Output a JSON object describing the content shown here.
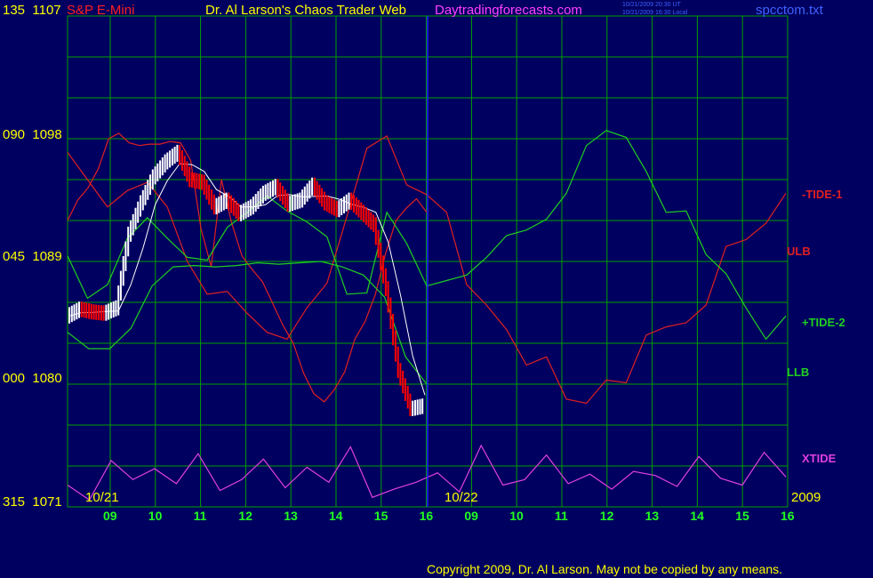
{
  "header": {
    "symbol": "S&P E-Mini",
    "title": "Dr. Al Larson's Chaos Trader Web",
    "site": "Daytradingforecasts.com",
    "stamp_ut": "10/21/2009 20:30 UT",
    "stamp_local": "10/21/2009 16:30 Local",
    "file": "spcctom.txt"
  },
  "footer": {
    "copyright": "Copyright 2009, Dr. Al Larson. May not be copied by any means."
  },
  "colors": {
    "background": "#000060",
    "grid": "#00a000",
    "price_up": "#ffffff",
    "price_down": "#ff0000",
    "red_line": "#e02020",
    "green_line": "#20d020",
    "xtide": "#e040e0",
    "divider": "#2020ff",
    "yellow": "#ffff00",
    "header_red": "#ff2020",
    "header_magenta": "#ff40ff",
    "header_blue": "#4060ff"
  },
  "chart_data": {
    "type": "line",
    "y_axis_labels": [
      {
        "left": "135",
        "right": "1107",
        "value": 1107
      },
      {
        "left": "090",
        "right": "1098",
        "value": 1098
      },
      {
        "left": "045",
        "right": "1089",
        "value": 1089
      },
      {
        "left": "000",
        "right": "1080",
        "value": 1080
      },
      {
        "left": "315",
        "right": "1071",
        "value": 1071
      }
    ],
    "ylim": [
      1071,
      1107
    ],
    "x_ticks": [
      "09",
      "10",
      "11",
      "12",
      "13",
      "14",
      "15",
      "16",
      "09",
      "10",
      "11",
      "12",
      "13",
      "14",
      "15",
      "16"
    ],
    "date_labels": [
      "10/21",
      "10/22",
      "2009"
    ],
    "grid": true,
    "series": [
      {
        "name": "-TIDE-1",
        "values": [
          1097.0,
          1095.0,
          1093.0,
          1094.2,
          1094.8,
          1093.0,
          1089.0,
          1086.6,
          1086.8,
          1085.2,
          1083.8,
          1083.3,
          1085.6,
          1087.4,
          1092.3,
          1097.3,
          1098.2,
          1094.6,
          1093.9,
          1092.6,
          1087.3,
          1085.8,
          1084.0,
          1081.4,
          1082.0,
          1078.9,
          1078.6,
          1080.3,
          1080.1,
          1083.6,
          1084.2,
          1084.5,
          1085.8,
          1090.1,
          1090.6,
          1091.8,
          1094.0
        ]
      },
      {
        "name": "ULB",
        "values": [
          1092.0,
          1093.5,
          1094.4,
          1095.8,
          1098.0,
          1098.4,
          1097.7,
          1097.5,
          1097.6,
          1097.6,
          1097.8,
          1097.7,
          1096.4,
          1091.4,
          1088.6,
          1095.0,
          1091.8,
          1089.4,
          1088.4,
          1087.5,
          1085.9,
          1084.3,
          1083.0,
          1080.8,
          1079.3,
          1078.7,
          1079.6,
          1080.9,
          1083.3,
          1084.6,
          1086.6,
          1089.6,
          1092.0,
          1092.9,
          1093.6,
          1092.6
        ]
      },
      {
        "name": "+TIDE-2",
        "values": [
          1089.4,
          1086.3,
          1087.3,
          1090.7,
          1092.2,
          1090.7,
          1089.3,
          1089.1,
          1091.5,
          1092.6,
          1093.8,
          1092.7,
          1091.9,
          1090.8,
          1086.6,
          1086.7,
          1092.6,
          1090.3,
          1087.2,
          1087.6,
          1088.0,
          1089.3,
          1090.9,
          1091.3,
          1092.1,
          1094.0,
          1097.5,
          1098.6,
          1098.1,
          1095.6,
          1092.6,
          1092.7,
          1089.5,
          1088.1,
          1085.6,
          1083.3,
          1085.0
        ]
      },
      {
        "name": "LLB",
        "values": [
          1083.8,
          1082.6,
          1082.6,
          1084.1,
          1087.2,
          1088.6,
          1088.7,
          1088.6,
          1088.7,
          1088.9,
          1088.8,
          1088.9,
          1089.0,
          1088.6,
          1088.0,
          1086.4,
          1082.0,
          1080.0
        ]
      },
      {
        "name": "XTIDE",
        "values": [
          1072.6,
          1071.5,
          1074.4,
          1073.0,
          1073.8,
          1072.7,
          1074.9,
          1072.2,
          1073.0,
          1074.5,
          1072.4,
          1073.9,
          1072.8,
          1075.4,
          1071.7,
          1072.3,
          1072.8,
          1073.5,
          1072.1,
          1075.5,
          1072.6,
          1073.0,
          1074.8,
          1072.7,
          1073.4,
          1072.3,
          1073.6,
          1073.3,
          1072.5,
          1074.7,
          1073.1,
          1072.6,
          1075.0,
          1073.2
        ]
      },
      {
        "name": "price",
        "values": [
          1085.0,
          1085.5,
          1085.3,
          1085.2,
          1085.6,
          1091.0,
          1093.3,
          1095.2,
          1096.3,
          1097.0,
          1095.0,
          1094.8,
          1093.0,
          1093.5,
          1092.5,
          1093.0,
          1094.0,
          1094.5,
          1093.2,
          1093.5,
          1094.6,
          1093.3,
          1092.8,
          1093.5,
          1092.6,
          1091.7,
          1087.0,
          1081.0,
          1078.2,
          1078.4
        ]
      }
    ]
  }
}
